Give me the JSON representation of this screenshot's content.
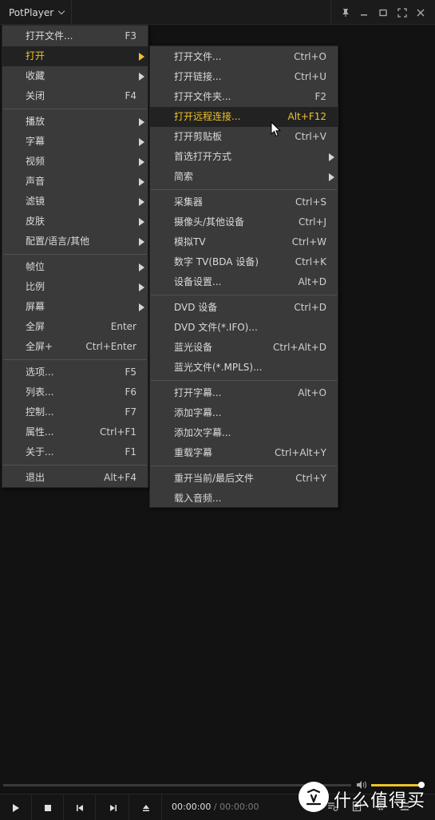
{
  "app": {
    "title": "PotPlayer"
  },
  "main_menu": [
    {
      "label": "打开文件...",
      "shortcut": "F3",
      "submenu": false
    },
    {
      "label": "打开",
      "shortcut": "",
      "submenu": true,
      "highlighted": true
    },
    {
      "label": "收藏",
      "shortcut": "",
      "submenu": true
    },
    {
      "label": "关闭",
      "shortcut": "F4",
      "submenu": false
    },
    {
      "label": "播放",
      "shortcut": "",
      "submenu": true
    },
    {
      "label": "字幕",
      "shortcut": "",
      "submenu": true
    },
    {
      "label": "视频",
      "shortcut": "",
      "submenu": true
    },
    {
      "label": "声音",
      "shortcut": "",
      "submenu": true
    },
    {
      "label": "滤镜",
      "shortcut": "",
      "submenu": true
    },
    {
      "label": "皮肤",
      "shortcut": "",
      "submenu": true
    },
    {
      "label": "配置/语言/其他",
      "shortcut": "",
      "submenu": true
    },
    {
      "label": "帧位",
      "shortcut": "",
      "submenu": true
    },
    {
      "label": "比例",
      "shortcut": "",
      "submenu": true
    },
    {
      "label": "屏幕",
      "shortcut": "",
      "submenu": true
    },
    {
      "label": "全屏",
      "shortcut": "Enter",
      "submenu": false
    },
    {
      "label": "全屏+",
      "shortcut": "Ctrl+Enter",
      "submenu": false
    },
    {
      "label": "选项...",
      "shortcut": "F5",
      "submenu": false
    },
    {
      "label": "列表...",
      "shortcut": "F6",
      "submenu": false
    },
    {
      "label": "控制...",
      "shortcut": "F7",
      "submenu": false
    },
    {
      "label": "属性...",
      "shortcut": "Ctrl+F1",
      "submenu": false
    },
    {
      "label": "关于...",
      "shortcut": "F1",
      "submenu": false
    },
    {
      "label": "退出",
      "shortcut": "Alt+F4",
      "submenu": false
    }
  ],
  "open_submenu": [
    {
      "label": "打开文件...",
      "shortcut": "Ctrl+O",
      "submenu": false
    },
    {
      "label": "打开链接...",
      "shortcut": "Ctrl+U",
      "submenu": false
    },
    {
      "label": "打开文件夹...",
      "shortcut": "F2",
      "submenu": false
    },
    {
      "label": "打开远程连接...",
      "shortcut": "Alt+F12",
      "submenu": false,
      "highlighted": true
    },
    {
      "label": "打开剪贴板",
      "shortcut": "Ctrl+V",
      "submenu": false
    },
    {
      "label": "首选打开方式",
      "shortcut": "",
      "submenu": true
    },
    {
      "label": "简索",
      "shortcut": "",
      "submenu": true
    },
    {
      "label": "采集器",
      "shortcut": "Ctrl+S",
      "submenu": false
    },
    {
      "label": "摄像头/其他设备",
      "shortcut": "Ctrl+J",
      "submenu": false
    },
    {
      "label": "模拟TV",
      "shortcut": "Ctrl+W",
      "submenu": false
    },
    {
      "label": "数字 TV(BDA 设备)",
      "shortcut": "Ctrl+K",
      "submenu": false
    },
    {
      "label": "设备设置...",
      "shortcut": "Alt+D",
      "submenu": false
    },
    {
      "label": "DVD 设备",
      "shortcut": "Ctrl+D",
      "submenu": false
    },
    {
      "label": "DVD 文件(*.IFO)...",
      "shortcut": "",
      "submenu": false
    },
    {
      "label": "蓝光设备",
      "shortcut": "Ctrl+Alt+D",
      "submenu": false
    },
    {
      "label": "蓝光文件(*.MPLS)...",
      "shortcut": "",
      "submenu": false
    },
    {
      "label": "打开字幕...",
      "shortcut": "Alt+O",
      "submenu": false
    },
    {
      "label": "添加字幕...",
      "shortcut": "",
      "submenu": false
    },
    {
      "label": "添加次字幕...",
      "shortcut": "",
      "submenu": false
    },
    {
      "label": "重载字幕",
      "shortcut": "Ctrl+Alt+Y",
      "submenu": false
    },
    {
      "label": "重开当前/最后文件",
      "shortcut": "Ctrl+Y",
      "submenu": false
    },
    {
      "label": "载入音频...",
      "shortcut": "",
      "submenu": false
    }
  ],
  "player": {
    "current_time": "00:00:00",
    "separator": "/",
    "total_time": "00:00:00",
    "volume": 1.0
  },
  "watermark": {
    "logo_text": "值",
    "text": "什么值得买"
  },
  "colors": {
    "highlight": "#f0c22a",
    "menu_bg": "#3a3a3a",
    "background": "#121212"
  }
}
